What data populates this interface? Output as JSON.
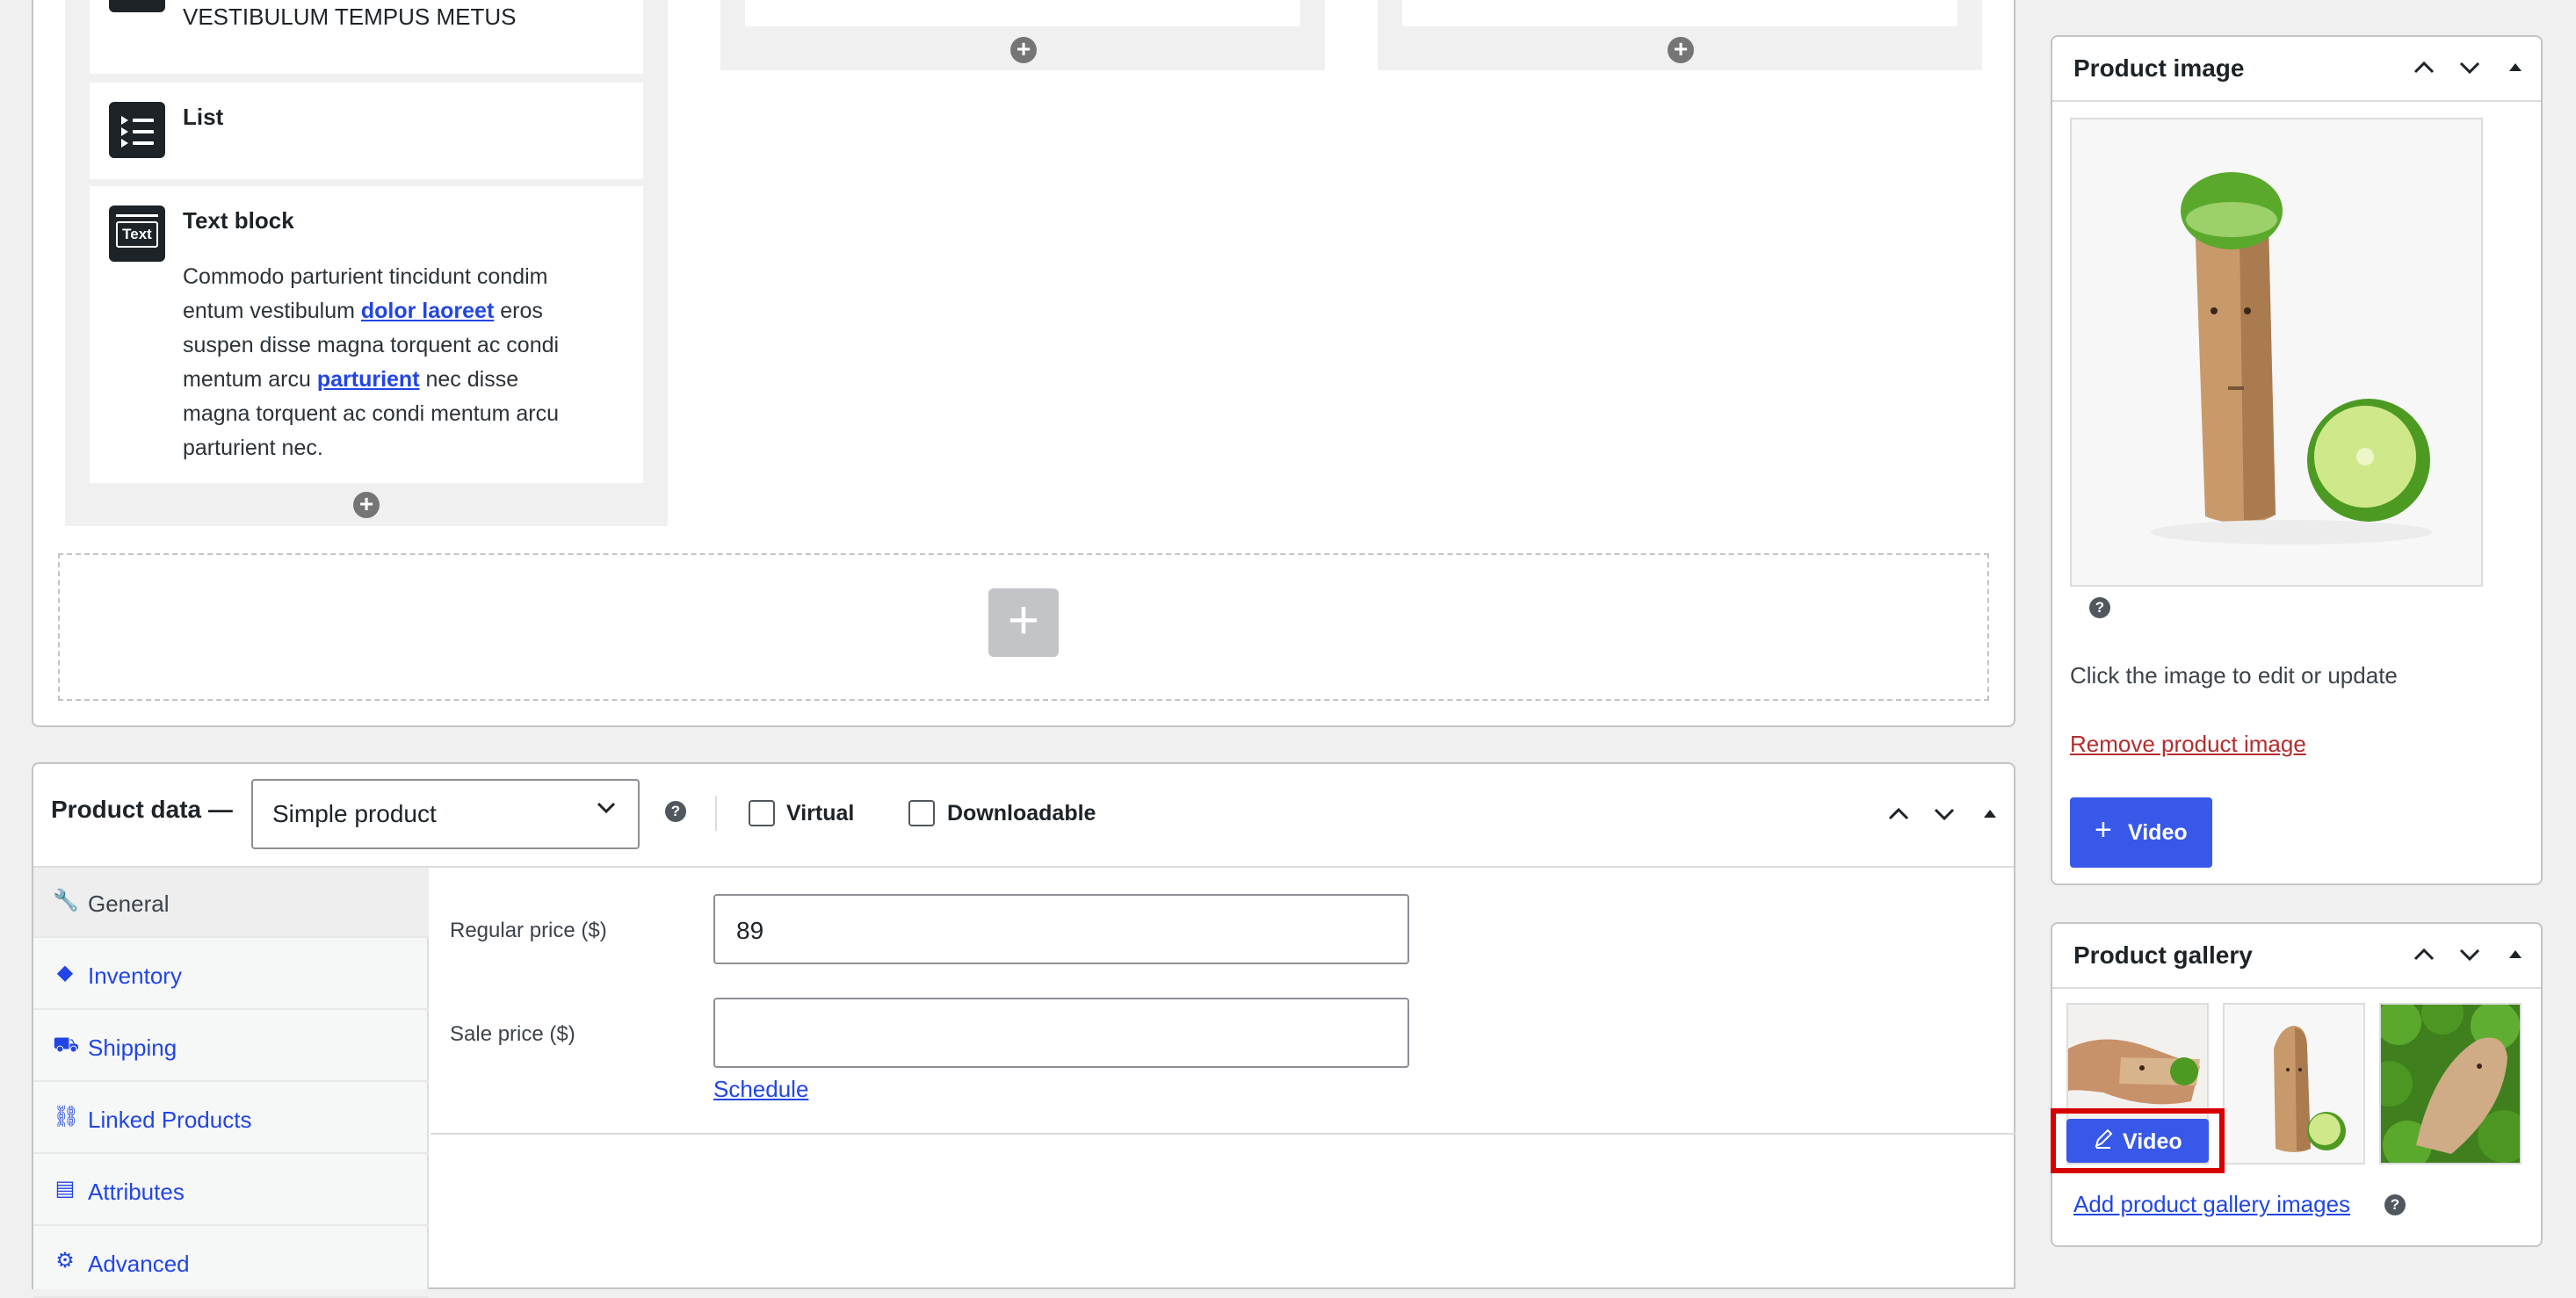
{
  "builder": {
    "first_block_text": "VESTIBULUM TEMPUS METUS",
    "list_block": {
      "title": "List",
      "icon": "list-icon"
    },
    "text_block": {
      "title": "Text block",
      "icon": "text-block-icon",
      "icon_text": "Text",
      "lines": [
        {
          "parts": [
            {
              "t": "Commodo parturient tincidunt condim"
            }
          ]
        },
        {
          "parts": [
            {
              "t": "entum vestibulum "
            },
            {
              "t": "dolor laoreet",
              "link": true
            },
            {
              "t": " eros"
            }
          ]
        },
        {
          "parts": [
            {
              "t": "suspen disse magna torquent ac condi"
            }
          ]
        },
        {
          "parts": [
            {
              "t": "mentum arcu "
            },
            {
              "t": "parturient",
              "link": true
            },
            {
              "t": " nec disse"
            }
          ]
        },
        {
          "parts": [
            {
              "t": "magna torquent ac condi mentum arcu"
            }
          ]
        },
        {
          "parts": [
            {
              "t": "parturient nec."
            }
          ]
        }
      ]
    },
    "add_block_symbol": "+",
    "add_row_symbol": "+"
  },
  "product_data": {
    "title": "Product data —",
    "type_select": {
      "value": "Simple product"
    },
    "virtual_label": "Virtual",
    "downloadable_label": "Downloadable",
    "tabs": [
      {
        "label": "General",
        "icon": "wrench-icon",
        "glyph": "🔧",
        "active": true
      },
      {
        "label": "Inventory",
        "icon": "tag-icon",
        "glyph": "◆",
        "active": false
      },
      {
        "label": "Shipping",
        "icon": "truck-icon",
        "glyph": "⛟",
        "active": false
      },
      {
        "label": "Linked Products",
        "icon": "link-icon",
        "glyph": "⛓",
        "active": false
      },
      {
        "label": "Attributes",
        "icon": "attributes-icon",
        "glyph": "▤",
        "active": false
      },
      {
        "label": "Advanced",
        "icon": "gear-icon",
        "glyph": "⚙",
        "active": false
      }
    ],
    "regular_price_label": "Regular price ($)",
    "regular_price_value": "89",
    "sale_price_label": "Sale price ($)",
    "sale_price_value": "",
    "schedule_label": "Schedule"
  },
  "product_image": {
    "title": "Product image",
    "help_text": "Click the image to edit or update",
    "remove_link": "Remove product image",
    "video_button": "Video"
  },
  "product_gallery": {
    "title": "Product gallery",
    "video_button": "Video",
    "add_link": "Add product gallery images"
  },
  "colors": {
    "accent": "#3858e9",
    "link": "#2145e6",
    "danger": "#b32d2e",
    "highlight": "#d60000"
  }
}
